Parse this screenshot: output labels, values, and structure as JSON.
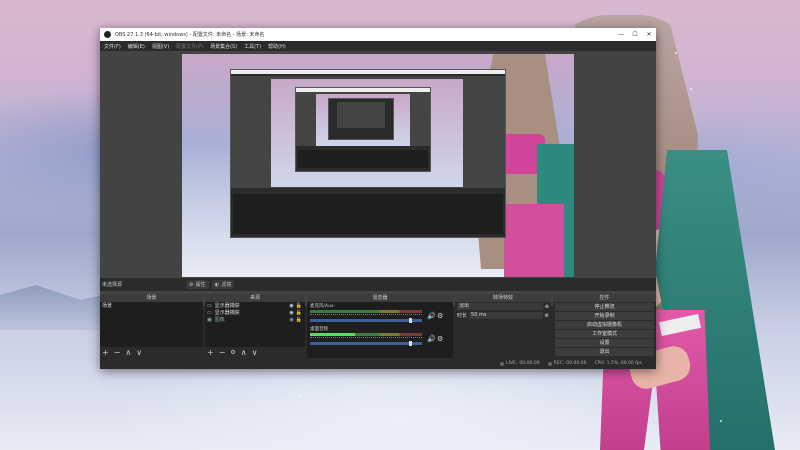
{
  "window": {
    "title": "OBS 27.1.3 (64-bit, windows) - 配置文件: 未命名 - 场景: 未命名",
    "min": "—",
    "max": "☐",
    "close": "✕"
  },
  "menu": {
    "items": [
      {
        "label": "文件(F)",
        "disabled": false
      },
      {
        "label": "编辑(E)",
        "disabled": false
      },
      {
        "label": "视图(V)",
        "disabled": false
      },
      {
        "label": "配置文件(P)",
        "disabled": true
      },
      {
        "label": "场景集合(S)",
        "disabled": false
      },
      {
        "label": "工具(T)",
        "disabled": false
      },
      {
        "label": "帮助(H)",
        "disabled": false
      }
    ]
  },
  "preview_bar": {
    "no_source": "未选择源",
    "properties": "属性",
    "filters": "滤镜"
  },
  "docks": {
    "scenes": {
      "title": "场景",
      "items": [
        "场景"
      ]
    },
    "sources": {
      "title": "来源",
      "items": [
        {
          "label": "显示器捕获",
          "icon": "monitor-icon",
          "visible": true,
          "locked": false
        },
        {
          "label": "显示器捕获",
          "icon": "monitor-icon",
          "visible": true,
          "locked": false
        },
        {
          "label": "图像",
          "icon": "image-icon",
          "visible": true,
          "locked": false
        }
      ]
    },
    "mixer": {
      "title": "混音器",
      "tracks": [
        {
          "name": "麦克风/Aux",
          "level": 0.0
        },
        {
          "name": "桌面音频",
          "level": 0.4
        }
      ]
    },
    "transitions": {
      "title": "转场特效",
      "selected": "淡出",
      "duration_label": "时长",
      "duration_value": "50 ms"
    },
    "controls": {
      "title": "控件",
      "buttons": [
        "停止推流",
        "开始录制",
        "启动虚拟摄像机",
        "工作室模式",
        "设置",
        "退出"
      ]
    }
  },
  "statusbar": {
    "live_label": "LIVE:",
    "live_time": "00:00:00",
    "rec_label": "REC:",
    "rec_time": "00:00:00",
    "cpu": "CPU: 1.5%, 60.00 fps"
  }
}
